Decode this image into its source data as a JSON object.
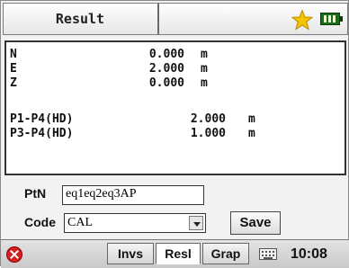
{
  "window": {
    "title": "Result",
    "star_icon": "star-icon",
    "battery_icon": "battery-icon",
    "star_color": "#f5c400",
    "battery_color": "#1d6c1b"
  },
  "results": {
    "coords": [
      {
        "label": "N",
        "value": "0.000",
        "unit": "m"
      },
      {
        "label": "E",
        "value": "2.000",
        "unit": "m"
      },
      {
        "label": "Z",
        "value": "0.000",
        "unit": "m"
      }
    ],
    "distances": [
      {
        "label": "P1-P4(HD)",
        "value": "2.000",
        "unit": "m"
      },
      {
        "label": "P3-P4(HD)",
        "value": "1.000",
        "unit": "m"
      }
    ]
  },
  "form": {
    "ptn_label": "PtN",
    "ptn_value": "eq1eq2eq3AP",
    "code_label": "Code",
    "code_value": "CAL",
    "save_label": "Save"
  },
  "taskbar": {
    "tabs": [
      "Invs",
      "Resl",
      "Grap"
    ],
    "active_tab": "Resl",
    "time": "10:08",
    "close_color": "#d81f1f"
  }
}
